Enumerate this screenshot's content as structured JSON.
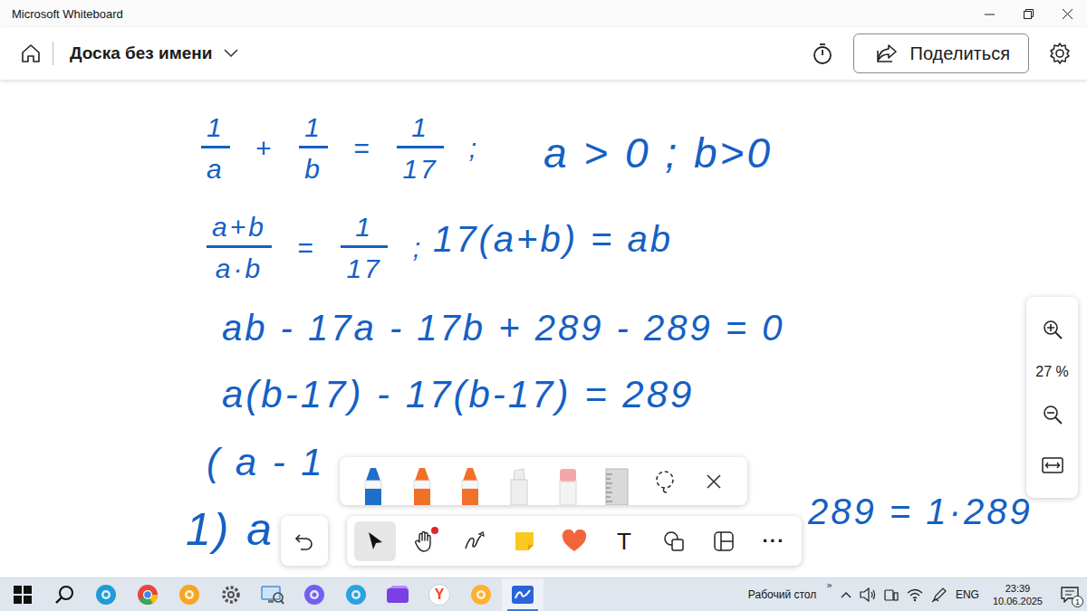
{
  "window": {
    "title": "Microsoft Whiteboard"
  },
  "header": {
    "board_name": "Доска без имени",
    "share_label": "Поделиться"
  },
  "canvas": {
    "ink": [
      {
        "kind": "equation",
        "parts": [
          {
            "kind": "fraction",
            "num": "1",
            "den": "a"
          },
          {
            "kind": "symbol",
            "text": "+"
          },
          {
            "kind": "fraction",
            "num": "1",
            "den": "b"
          },
          {
            "kind": "symbol",
            "text": "="
          },
          {
            "kind": "fraction",
            "num": "1",
            "den": "17"
          },
          {
            "kind": "symbol",
            "text": ";"
          }
        ]
      },
      {
        "kind": "line",
        "parts": [
          {
            "kind": "text",
            "text": "a > 0 ; b>0"
          }
        ]
      },
      {
        "kind": "equation",
        "parts": [
          {
            "kind": "fraction",
            "num": "a+b",
            "den": "a·b"
          },
          {
            "kind": "symbol",
            "text": "="
          },
          {
            "kind": "fraction",
            "num": "1",
            "den": "17"
          },
          {
            "kind": "symbol",
            "text": ";"
          }
        ]
      },
      {
        "kind": "line",
        "parts": [
          {
            "kind": "text",
            "text": "17(a+b) = ab"
          }
        ]
      },
      {
        "kind": "line",
        "parts": [
          {
            "kind": "text",
            "text": "ab - 17a - 17b + 289 - 289 = 0"
          }
        ]
      },
      {
        "kind": "line",
        "parts": [
          {
            "kind": "text",
            "text": "a(b-17) - 17(b-17) = 289"
          }
        ]
      },
      {
        "kind": "line",
        "parts": [
          {
            "kind": "text",
            "text": "( a - 1"
          }
        ]
      },
      {
        "kind": "line",
        "parts": [
          {
            "kind": "text",
            "text": "1) a"
          }
        ]
      },
      {
        "kind": "line",
        "parts": [
          {
            "kind": "text",
            "text": "289 = 1·289"
          }
        ]
      }
    ]
  },
  "zoom": {
    "label": "27 %"
  },
  "pen_tray": {
    "items": [
      {
        "kind": "pen",
        "color": "#1e6fc8"
      },
      {
        "kind": "pen",
        "color": "#f07125"
      },
      {
        "kind": "pen",
        "color": "#f3702a"
      },
      {
        "kind": "highlighter",
        "color": "#eeeeee"
      },
      {
        "kind": "eraser",
        "color": "#f4a6ab"
      },
      {
        "kind": "ruler",
        "color": "#d9d9d9"
      },
      {
        "kind": "lasso",
        "color": "#333333"
      },
      {
        "kind": "close",
        "color": "#333333"
      }
    ]
  },
  "toolbar": {
    "tools": [
      {
        "kind": "select",
        "selected": true,
        "dot": false,
        "label": ""
      },
      {
        "kind": "hand",
        "selected": false,
        "dot": true,
        "label": ""
      },
      {
        "kind": "pen",
        "selected": false,
        "dot": false,
        "label": ""
      },
      {
        "kind": "note",
        "selected": false,
        "dot": false,
        "label": ""
      },
      {
        "kind": "reaction",
        "selected": false,
        "dot": false,
        "label": ""
      },
      {
        "kind": "text",
        "selected": false,
        "dot": false,
        "label": "T"
      },
      {
        "kind": "shapes",
        "selected": false,
        "dot": false,
        "label": ""
      },
      {
        "kind": "template",
        "selected": false,
        "dot": false,
        "label": ""
      },
      {
        "kind": "more",
        "selected": false,
        "dot": false,
        "label": "···"
      }
    ]
  },
  "taskbar": {
    "apps": [
      {
        "kind": "edge",
        "active": false,
        "label": ""
      },
      {
        "kind": "chrome",
        "active": false,
        "label": ""
      },
      {
        "kind": "browser",
        "active": false,
        "label": ""
      },
      {
        "kind": "settings",
        "active": false,
        "label": ""
      },
      {
        "kind": "remote",
        "active": false,
        "label": ""
      },
      {
        "kind": "viber",
        "active": false,
        "label": ""
      },
      {
        "kind": "telegram",
        "active": false,
        "label": ""
      },
      {
        "kind": "video",
        "active": false,
        "label": ""
      },
      {
        "kind": "yandex",
        "active": false,
        "label": "Y"
      },
      {
        "kind": "music",
        "active": false,
        "label": ""
      },
      {
        "kind": "whiteboard",
        "active": true,
        "label": ""
      }
    ],
    "tray": {
      "desktop_label": "Рабочий стол",
      "overflow": "»",
      "language": "ENG",
      "time": "23:39",
      "date": "10.06.2025",
      "notifications": "1"
    }
  }
}
